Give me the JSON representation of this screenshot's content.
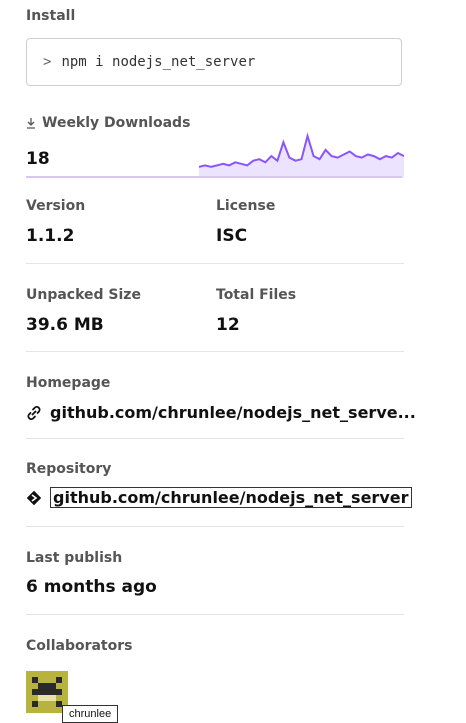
{
  "install": {
    "label": "Install",
    "prompt": ">",
    "command": "npm i nodejs_net_server"
  },
  "weekly_downloads": {
    "label": "Weekly Downloads",
    "value": "18",
    "sparkline": [
      2,
      3,
      2,
      3,
      4,
      3,
      5,
      4,
      3,
      6,
      7,
      5,
      9,
      6,
      18,
      8,
      6,
      7,
      22,
      9,
      7,
      13,
      9,
      8,
      10,
      12,
      9,
      8,
      10,
      9,
      7,
      9,
      8,
      11,
      9
    ]
  },
  "version": {
    "label": "Version",
    "value": "1.1.2"
  },
  "license": {
    "label": "License",
    "value": "ISC"
  },
  "unpacked_size": {
    "label": "Unpacked Size",
    "value": "39.6 MB"
  },
  "total_files": {
    "label": "Total Files",
    "value": "12"
  },
  "homepage": {
    "label": "Homepage",
    "value": "github.com/chrunlee/nodejs_net_serve..."
  },
  "repository": {
    "label": "Repository",
    "value": "github.com/chrunlee/nodejs_net_server"
  },
  "last_publish": {
    "label": "Last publish",
    "value": "6 months ago"
  },
  "collaborators": {
    "label": "Collaborators",
    "tooltip": "chrunlee"
  },
  "colors": {
    "accent": "#8956ff",
    "accent_fill": "#ece4ff",
    "avatar": "#b8b23e"
  }
}
